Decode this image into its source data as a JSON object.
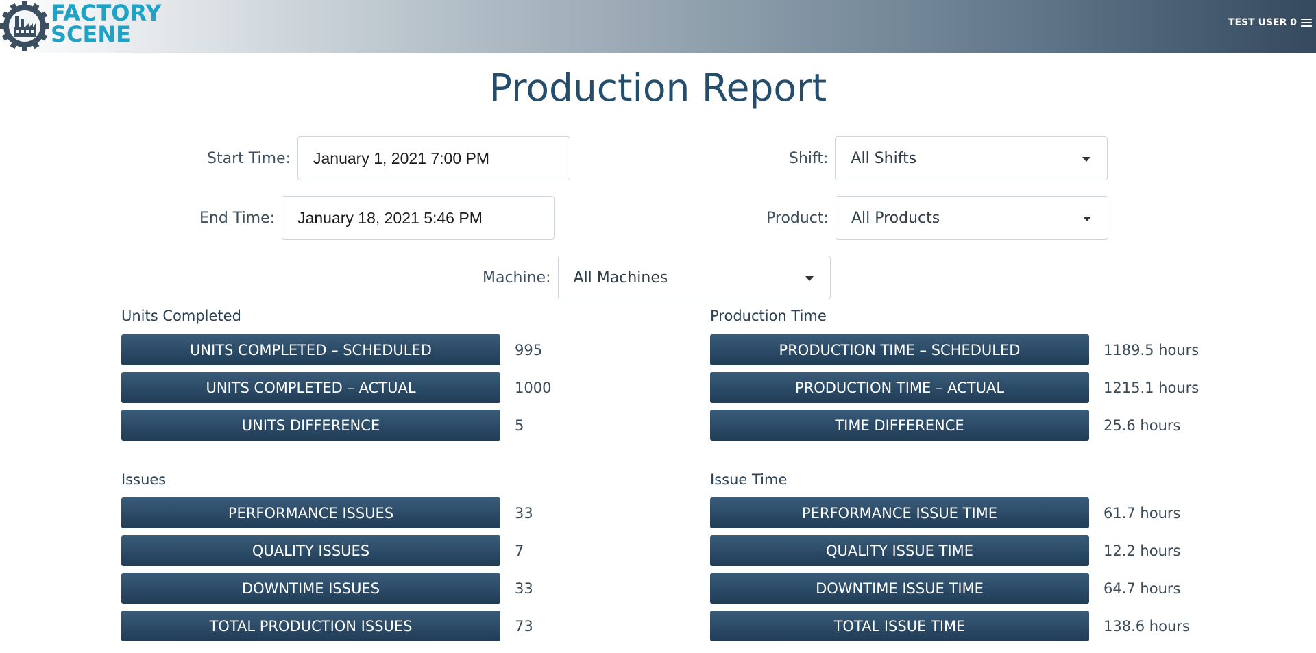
{
  "header": {
    "logo_line1": "FACTORY",
    "logo_line2": "SCENE",
    "user_label": "TEST USER 0",
    "accent_color": "#1ea3c7",
    "bar_dark_color": "#34495e"
  },
  "title": "Production Report",
  "filters": {
    "start_time": {
      "label": "Start Time:",
      "value": "January 1, 2021 7:00 PM"
    },
    "end_time": {
      "label": "End Time:",
      "value": "January 18, 2021 5:46 PM"
    },
    "shift": {
      "label": "Shift:",
      "value": "All Shifts"
    },
    "product": {
      "label": "Product:",
      "value": "All Products"
    },
    "machine": {
      "label": "Machine:",
      "value": "All Machines"
    }
  },
  "sections": {
    "units": {
      "title": "Units Completed",
      "rows": [
        {
          "label": "UNITS COMPLETED – SCHEDULED",
          "value": "995"
        },
        {
          "label": "UNITS COMPLETED – ACTUAL",
          "value": "1000"
        },
        {
          "label": "UNITS DIFFERENCE",
          "value": "5"
        }
      ]
    },
    "production_time": {
      "title": "Production Time",
      "rows": [
        {
          "label": "PRODUCTION TIME – SCHEDULED",
          "value": "1189.5 hours"
        },
        {
          "label": "PRODUCTION TIME – ACTUAL",
          "value": "1215.1 hours"
        },
        {
          "label": "TIME DIFFERENCE",
          "value": "25.6 hours"
        }
      ]
    },
    "issues": {
      "title": "Issues",
      "rows": [
        {
          "label": "PERFORMANCE ISSUES",
          "value": "33"
        },
        {
          "label": "QUALITY ISSUES",
          "value": "7"
        },
        {
          "label": "DOWNTIME ISSUES",
          "value": "33"
        },
        {
          "label": "TOTAL PRODUCTION ISSUES",
          "value": "73"
        }
      ]
    },
    "issue_time": {
      "title": "Issue Time",
      "rows": [
        {
          "label": "PERFORMANCE ISSUE TIME",
          "value": "61.7 hours"
        },
        {
          "label": "QUALITY ISSUE TIME",
          "value": "12.2 hours"
        },
        {
          "label": "DOWNTIME ISSUE TIME",
          "value": "64.7 hours"
        },
        {
          "label": "TOTAL ISSUE TIME",
          "value": "138.6 hours"
        }
      ]
    }
  }
}
